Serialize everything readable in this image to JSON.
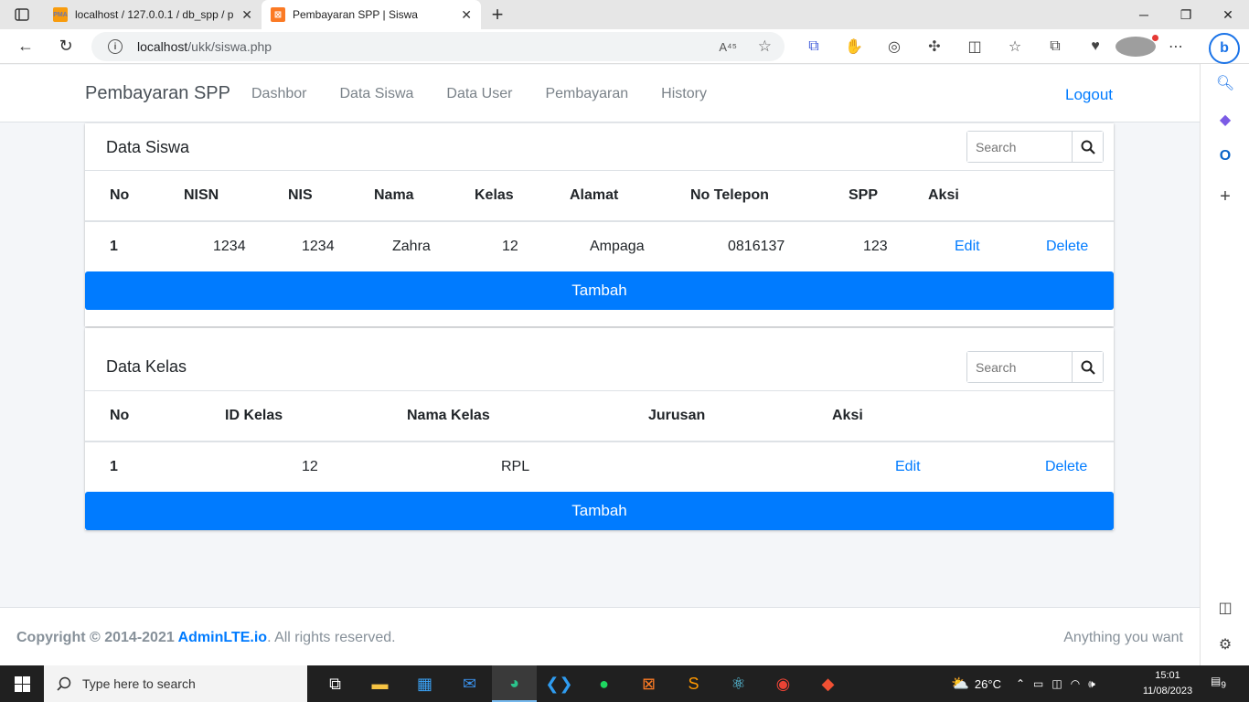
{
  "browser": {
    "tabs": [
      {
        "title": "localhost / 127.0.0.1 / db_spp / p",
        "favicon": "phpmyadmin-icon",
        "active": false
      },
      {
        "title": "Pembayaran SPP | Siswa",
        "favicon": "xampp-icon",
        "active": true
      }
    ],
    "url_host": "localhost",
    "url_path": "/ukk/siswa.php",
    "read_aloud": "A⁴⁵"
  },
  "nav": {
    "brand": "Pembayaran SPP",
    "links": [
      "Dashbor",
      "Data Siswa",
      "Data User",
      "Pembayaran",
      "History"
    ],
    "logout": "Logout"
  },
  "siswa": {
    "title": "Data Siswa",
    "search_placeholder": "Search",
    "headers": [
      "No",
      "NISN",
      "NIS",
      "Nama",
      "Kelas",
      "Alamat",
      "No Telepon",
      "SPP",
      "Aksi"
    ],
    "rows": [
      {
        "no": "1",
        "nisn": "1234",
        "nis": "1234",
        "nama": "Zahra",
        "kelas": "12",
        "alamat": "Ampaga",
        "telepon": "0816137",
        "spp": "123",
        "edit": "Edit",
        "delete": "Delete"
      }
    ],
    "add_label": "Tambah"
  },
  "kelas": {
    "title": "Data Kelas",
    "search_placeholder": "Search",
    "headers": [
      "No",
      "ID Kelas",
      "Nama Kelas",
      "Jurusan",
      "Aksi"
    ],
    "rows": [
      {
        "no": "1",
        "id": "12",
        "nama": "RPL",
        "jurusan": "",
        "edit": "Edit",
        "delete": "Delete"
      }
    ],
    "add_label": "Tambah"
  },
  "footer": {
    "copyright_prefix": "Copyright © 2014-2021 ",
    "brand_link": "AdminLTE.io",
    "suffix": ". All rights reserved.",
    "right": "Anything you want"
  },
  "taskbar": {
    "search_placeholder": "Type here to search",
    "temperature": "26°C",
    "time": "15:01",
    "date": "11/08/2023",
    "notification_count": "9"
  },
  "colors": {
    "primary": "#007bff",
    "taskbar": "#202020"
  }
}
